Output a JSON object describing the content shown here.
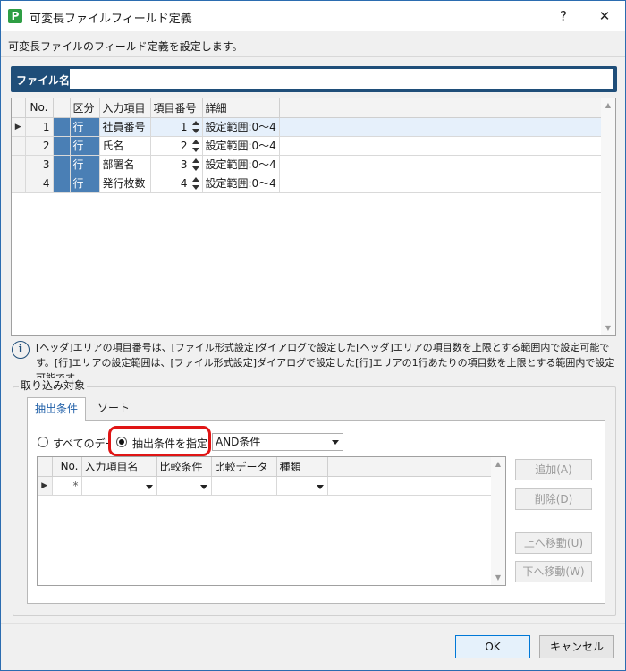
{
  "window": {
    "title": "可変長ファイルフィールド定義",
    "app_icon": "P",
    "help_label": "?",
    "close_label": "✕"
  },
  "description": "可変長ファイルのフィールド定義を設定します。",
  "file_name": {
    "label": "ファイル名:",
    "value": ""
  },
  "field_table": {
    "headers": [
      "No.",
      "",
      "区分",
      "入力項目",
      "項目番号",
      "詳細"
    ],
    "rows": [
      {
        "no": "1",
        "kubun": "行",
        "item": "社員番号",
        "num": "1",
        "detail": "設定範囲:0〜4"
      },
      {
        "no": "2",
        "kubun": "行",
        "item": "氏名",
        "num": "2",
        "detail": "設定範囲:0〜4"
      },
      {
        "no": "3",
        "kubun": "行",
        "item": "部署名",
        "num": "3",
        "detail": "設定範囲:0〜4"
      },
      {
        "no": "4",
        "kubun": "行",
        "item": "発行枚数",
        "num": "4",
        "detail": "設定範囲:0〜4"
      }
    ]
  },
  "info": {
    "icon": "info-icon",
    "text": "[ヘッダ]エリアの項目番号は、[ファイル形式設定]ダイアログで設定した[ヘッダ]エリアの項目数を上限とする範囲内で設定可能です。[行]エリアの設定範囲は、[ファイル形式設定]ダイアログで設定した[行]エリアの1行あたりの項目数を上限とする範囲内で設定可能です。"
  },
  "import_target": {
    "title": "取り込み対象",
    "tabs": [
      "抽出条件",
      "ソート"
    ],
    "radio_all": "すべてのデータ",
    "radio_cond": "抽出条件を指定:",
    "combo_value": "AND条件",
    "cond_table": {
      "headers": [
        "",
        "No.",
        "入力項目名",
        "比較条件",
        "比較データ",
        "種類"
      ],
      "new_row_marker": "*"
    },
    "buttons": {
      "add": "追加(A)",
      "delete": "削除(D)",
      "up": "上へ移動(U)",
      "down": "下へ移動(W)"
    }
  },
  "footer": {
    "ok": "OK",
    "cancel": "キャンセル"
  },
  "colors": {
    "accent": "#1f4e79",
    "kubun_cell": "#4a7fb5",
    "highlight": "#e01515"
  }
}
